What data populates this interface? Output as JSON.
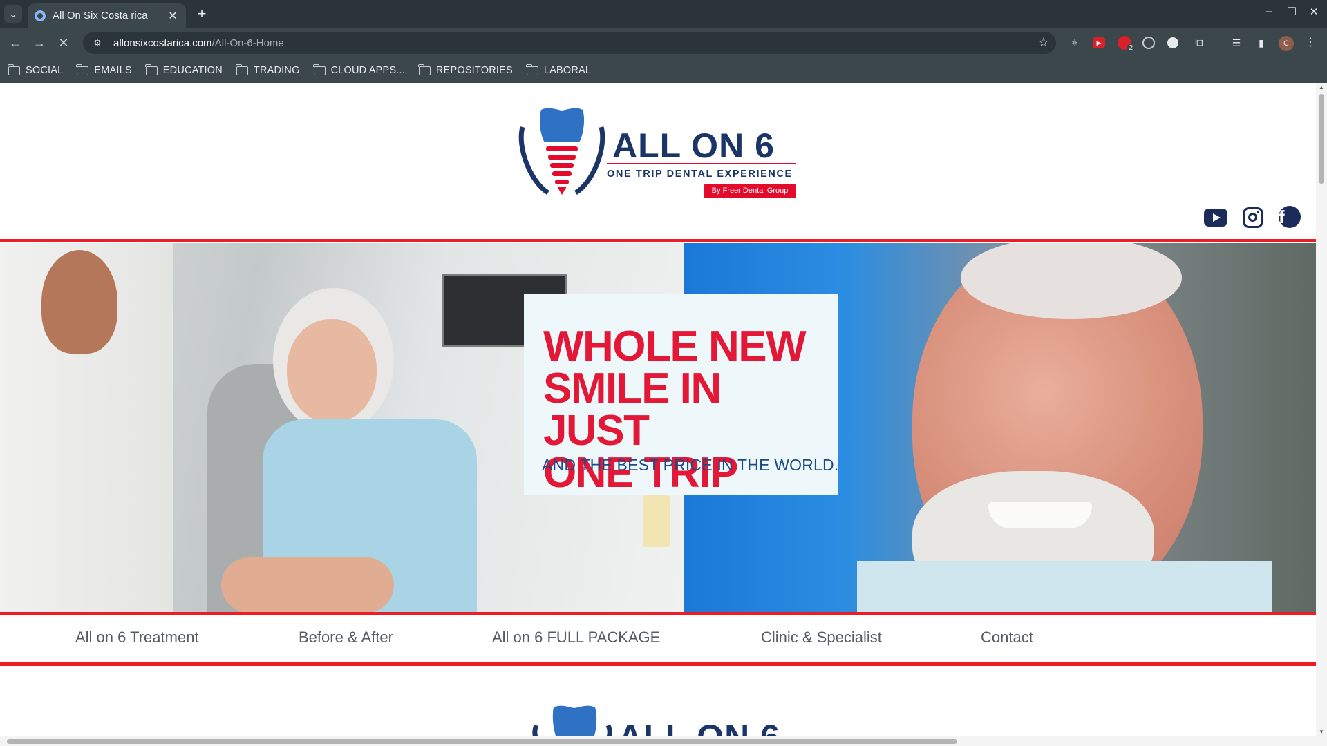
{
  "browser": {
    "tab_title": "All On Six Costa rica",
    "tab_close": "✕",
    "new_tab": "+",
    "url_host": "allonsixcostarica.com",
    "url_path": "/All-On-6-Home",
    "profile_initial": "C",
    "extension_badge": "2",
    "bookmarks": [
      "SOCIAL",
      "EMAILS",
      "EDUCATION",
      "TRADING",
      "CLOUD APPS...",
      "REPOSITORIES",
      "LABORAL"
    ]
  },
  "site": {
    "logo": {
      "title": "ALL ON 6",
      "subtitle": "ONE TRIP DENTAL EXPERIENCE",
      "badge": "By Freer Dental Group"
    },
    "social": [
      "youtube-icon",
      "instagram-icon",
      "facebook-icon"
    ],
    "hero": {
      "headline_lines": [
        "WHOLE NEW",
        "SMILE IN JUST",
        "ONE TRIP"
      ],
      "subline": "AND THE BEST PRICE IN THE WORLD."
    },
    "menu": [
      "All on 6 Treatment",
      "Before & After",
      "All on 6 FULL PACKAGE",
      "Clinic & Specialist",
      "Contact"
    ],
    "colors": {
      "accent_red": "#ee1c25",
      "brand_navy": "#1b3566",
      "headline_red": "#e31837"
    }
  }
}
